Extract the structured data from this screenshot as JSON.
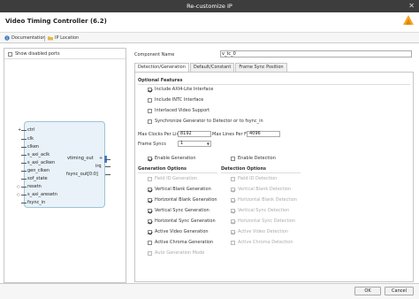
{
  "window": {
    "title": "Re-customize IP",
    "close_icon": "close-icon"
  },
  "header": {
    "ip_title": "Video Timing Controller (6.2)",
    "logo_icon": "vivado-logo-icon"
  },
  "toolbar": {
    "documentation_label": "Documentation",
    "ip_location_label": "IP Location",
    "documentation_icon": "info-icon",
    "ip_location_icon": "folder-icon"
  },
  "left": {
    "show_disabled_ports": "Show disabled ports",
    "ports_left": [
      "ctrl",
      "clk",
      "clken",
      "s_axi_aclk",
      "s_axi_aclken",
      "gen_clken",
      "sof_state",
      "resetn",
      "s_axi_aresetn",
      "fsync_in"
    ],
    "ports_right": [
      "vtiming_out",
      "irq",
      "fsync_out[0:0]"
    ]
  },
  "component": {
    "label": "Component Name",
    "value": "v_tc_0"
  },
  "tabs": [
    "Detection/Generation",
    "Default/Constant",
    "Frame Sync Position"
  ],
  "optional_features": {
    "title": "Optional Features",
    "items": [
      {
        "label": "Include AXI4-Lite Interface",
        "checked": true
      },
      {
        "label": "Include INTC Interface",
        "checked": false
      },
      {
        "label": "Interlaced Video Support",
        "checked": false
      },
      {
        "label": "Synchronize Generator to Detector or to fsync_in",
        "checked": false
      }
    ]
  },
  "fields": {
    "max_clocks_label": "Max Clocks Per Line",
    "max_clocks_value": "8192",
    "max_lines_label": "Max Lines Per Frame",
    "max_lines_value": "4096",
    "frame_syncs_label": "Frame Syncs",
    "frame_syncs_value": "1"
  },
  "enable": {
    "generation_label": "Enable Generation",
    "generation_checked": true,
    "detection_label": "Enable Detection",
    "detection_checked": false
  },
  "generation_options": {
    "title": "Generation Options",
    "items": [
      {
        "label": "Field ID Generation",
        "checked": false,
        "enabled": false
      },
      {
        "label": "Vertical Blank Generation",
        "checked": true,
        "enabled": true
      },
      {
        "label": "Horizontal Blank Generation",
        "checked": true,
        "enabled": true
      },
      {
        "label": "Vertical Sync Generation",
        "checked": true,
        "enabled": true
      },
      {
        "label": "Horizontal Sync Generation",
        "checked": true,
        "enabled": true
      },
      {
        "label": "Active Video Generation",
        "checked": true,
        "enabled": true
      },
      {
        "label": "Active Chroma Generation",
        "checked": false,
        "enabled": true
      },
      {
        "label": "Auto Generation Mode",
        "checked": false,
        "enabled": false
      }
    ]
  },
  "detection_options": {
    "title": "Detection Options",
    "items": [
      {
        "label": "Field ID Detection",
        "checked": false
      },
      {
        "label": "Vertical Blank Detection",
        "checked": true
      },
      {
        "label": "Horizontal Blank Detection",
        "checked": true
      },
      {
        "label": "Vertical Sync Detection",
        "checked": true
      },
      {
        "label": "Horizontal Sync Detection",
        "checked": true
      },
      {
        "label": "Active Video Detection",
        "checked": true
      },
      {
        "label": "Active Chroma Detection",
        "checked": false
      }
    ]
  },
  "footer": {
    "ok_label": "OK",
    "cancel_label": "Cancel"
  }
}
